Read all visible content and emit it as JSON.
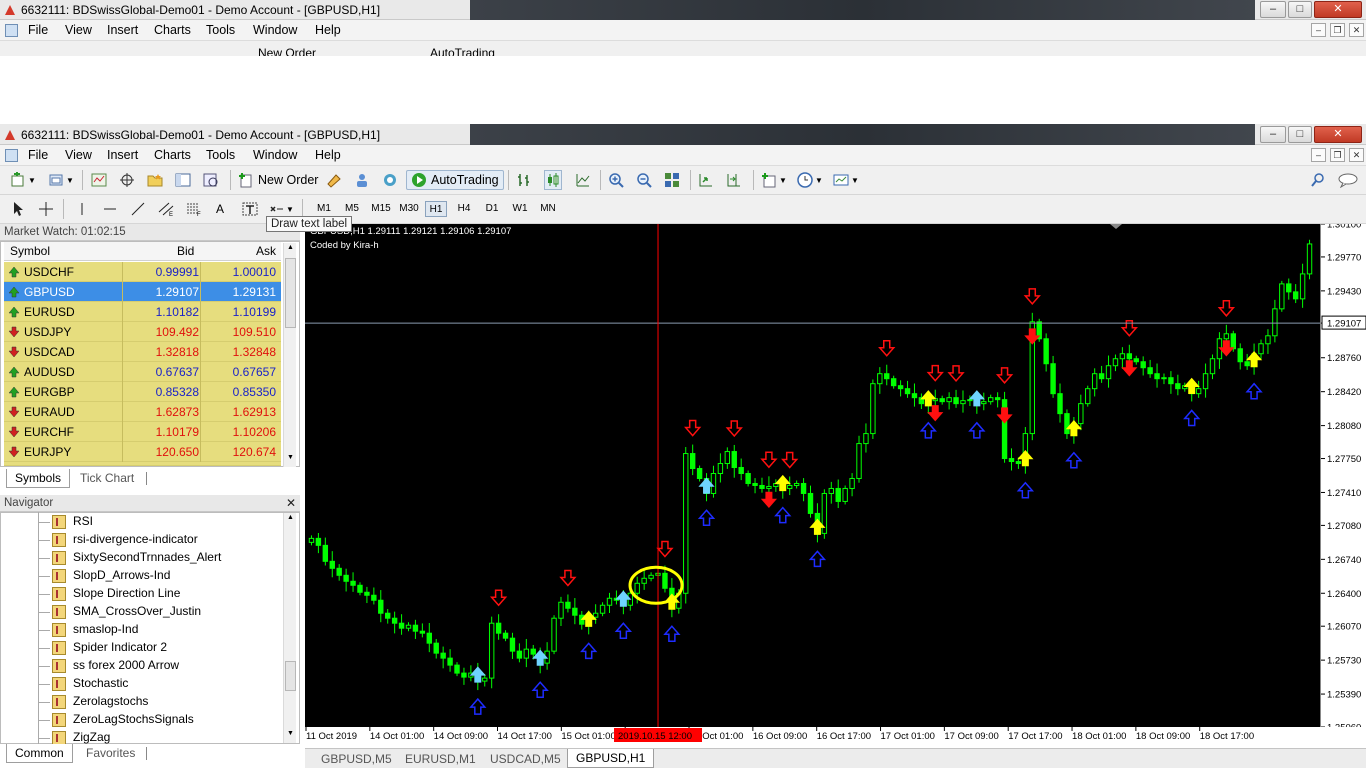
{
  "window": {
    "title": "6632111: BDSwissGlobal-Demo01 - Demo Account - [GBPUSD,H1]"
  },
  "menu": [
    "File",
    "View",
    "Insert",
    "Charts",
    "Tools",
    "Window",
    "Help"
  ],
  "toolbar": {
    "new_order": "New Order",
    "auto_trading": "AutoTrading"
  },
  "timeframes": [
    "M1",
    "M5",
    "M15",
    "M30",
    "H1",
    "H4",
    "D1",
    "W1",
    "MN"
  ],
  "active_timeframe": "H1",
  "tooltip": "Draw text label",
  "market_watch": {
    "title": "Market Watch: 01:02:15",
    "columns": [
      "Symbol",
      "Bid",
      "Ask"
    ],
    "rows": [
      {
        "symbol": "USDCHF",
        "bid": "0.99991",
        "ask": "1.00010",
        "dir": "up",
        "color": "blue"
      },
      {
        "symbol": "GBPUSD",
        "bid": "1.29107",
        "ask": "1.29131",
        "dir": "up",
        "color": "blue"
      },
      {
        "symbol": "EURUSD",
        "bid": "1.10182",
        "ask": "1.10199",
        "dir": "up",
        "color": "blue"
      },
      {
        "symbol": "USDJPY",
        "bid": "109.492",
        "ask": "109.510",
        "dir": "down",
        "color": "red"
      },
      {
        "symbol": "USDCAD",
        "bid": "1.32818",
        "ask": "1.32848",
        "dir": "down",
        "color": "red"
      },
      {
        "symbol": "AUDUSD",
        "bid": "0.67637",
        "ask": "0.67657",
        "dir": "up",
        "color": "blue"
      },
      {
        "symbol": "EURGBP",
        "bid": "0.85328",
        "ask": "0.85350",
        "dir": "up",
        "color": "blue"
      },
      {
        "symbol": "EURAUD",
        "bid": "1.62873",
        "ask": "1.62913",
        "dir": "down",
        "color": "red"
      },
      {
        "symbol": "EURCHF",
        "bid": "1.10179",
        "ask": "1.10206",
        "dir": "down",
        "color": "red"
      },
      {
        "symbol": "EURJPY",
        "bid": "120.650",
        "ask": "120.674",
        "dir": "down",
        "color": "red"
      }
    ],
    "selected_symbol": "GBPUSD",
    "tabs": [
      "Symbols",
      "Tick Chart"
    ]
  },
  "navigator": {
    "title": "Navigator",
    "items": [
      "RSI",
      "rsi-divergence-indicator",
      "SixtySecondTrnnades_Alert",
      "SlopD_Arrows-Ind",
      "Slope Direction Line",
      "SMA_CrossOver_Justin",
      "smaslop-Ind",
      "Spider Indicator 2",
      "ss forex 2000 Arrow",
      "Stochastic",
      "Zerolagstochs",
      "ZeroLagStochsSignals",
      "ZigZag"
    ],
    "tabs": [
      "Common",
      "Favorites"
    ]
  },
  "chart": {
    "header": "GBPUSD,H1  1.29111 1.29121 1.29106 1.29107",
    "subheader": "Coded by Kira-h",
    "current_price": "1.29107",
    "crosshair_time": "2019.10.15 12:00",
    "price_ticks": [
      "1.30100",
      "1.29770",
      "1.29430",
      "1.29107",
      "1.28760",
      "1.28420",
      "1.28080",
      "1.27750",
      "1.27410",
      "1.27080",
      "1.26740",
      "1.26400",
      "1.26070",
      "1.25730",
      "1.25390",
      "1.25060"
    ],
    "time_ticks": [
      "11 Oct 2019",
      "14 Oct 01:00",
      "14 Oct 09:00",
      "14 Oct 17:00",
      "15 Oct 01:00",
      "15 Oct 17:00",
      "16 Oct 01:00",
      "16 Oct 09:00",
      "16 Oct 17:00",
      "17 Oct 01:00",
      "17 Oct 09:00",
      "17 Oct 17:00",
      "18 Oct 01:00",
      "18 Oct 09:00",
      "18 Oct 17:00"
    ],
    "tabs": [
      "GBPUSD,M5",
      "EURUSD,M1",
      "USDCAD,M5",
      "GBPUSD,H1"
    ],
    "active_tab": "GBPUSD,H1",
    "colors": {
      "background": "#000000",
      "candle": "#00ff00",
      "arrow_up_yellow": "#ffff00",
      "arrow_down_red": "#ff1010",
      "arrow_up_blue": "#1e2cff",
      "arrow_up_cyan": "#6fd3ff",
      "crosshair": "#ff0000",
      "highlight_circle": "#ffff00"
    }
  },
  "chart_data": {
    "type": "candlestick",
    "symbol": "GBPUSD",
    "timeframe": "H1",
    "ylim": [
      1.2506,
      1.301
    ],
    "last": 1.29107,
    "closes": [
      1.2695,
      1.2688,
      1.2672,
      1.2665,
      1.2658,
      1.2652,
      1.2648,
      1.2641,
      1.2638,
      1.2633,
      1.262,
      1.2615,
      1.261,
      1.2605,
      1.2608,
      1.2602,
      1.26,
      1.259,
      1.258,
      1.2575,
      1.2568,
      1.256,
      1.2556,
      1.256,
      1.2552,
      1.2555,
      1.261,
      1.26,
      1.2595,
      1.2582,
      1.2575,
      1.2584,
      1.2579,
      1.257,
      1.2582,
      1.2615,
      1.2631,
      1.2625,
      1.2618,
      1.2609,
      1.2616,
      1.262,
      1.2628,
      1.2635,
      1.2633,
      1.2628,
      1.264,
      1.265,
      1.2655,
      1.2658,
      1.266,
      1.2645,
      1.2625,
      1.264,
      1.278,
      1.2765,
      1.2755,
      1.274,
      1.276,
      1.277,
      1.2782,
      1.2766,
      1.276,
      1.275,
      1.2748,
      1.2745,
      1.2747,
      1.275,
      1.2745,
      1.2748,
      1.275,
      1.274,
      1.272,
      1.27,
      1.274,
      1.2745,
      1.2732,
      1.2745,
      1.2755,
      1.279,
      1.28,
      1.285,
      1.286,
      1.2855,
      1.2848,
      1.2845,
      1.284,
      1.2836,
      1.283,
      1.2833,
      1.2835,
      1.2832,
      1.2836,
      1.283,
      1.2833,
      1.2834,
      1.283,
      1.2832,
      1.2836,
      1.2834,
      1.2775,
      1.2772,
      1.277,
      1.28,
      1.2912,
      1.2895,
      1.287,
      1.284,
      1.282,
      1.28,
      1.281,
      1.283,
      1.2845,
      1.286,
      1.2855,
      1.2868,
      1.2875,
      1.288,
      1.2875,
      1.2872,
      1.2866,
      1.286,
      1.2855,
      1.2856,
      1.285,
      1.2845,
      1.2848,
      1.284,
      1.2845,
      1.286,
      1.2875,
      1.2895,
      1.29,
      1.2885,
      1.2872,
      1.2868,
      1.288,
      1.289,
      1.2898,
      1.2925,
      1.295,
      1.2942,
      1.2935,
      1.296,
      1.299
    ]
  }
}
